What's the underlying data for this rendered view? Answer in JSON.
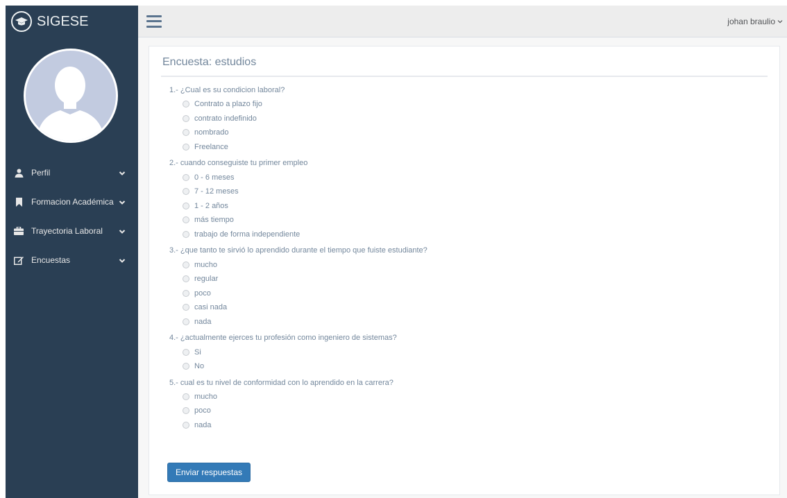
{
  "app": {
    "name": "SIGESE"
  },
  "sidebar": {
    "items": [
      {
        "label": "Perfil",
        "icon": "user-icon"
      },
      {
        "label": "Formacion Académica",
        "icon": "bookmark-icon"
      },
      {
        "label": "Trayectoria Laboral",
        "icon": "briefcase-icon"
      },
      {
        "label": "Encuestas",
        "icon": "edit-icon"
      }
    ]
  },
  "header": {
    "user": "johan braulio"
  },
  "survey": {
    "title": "Encuesta: estudios",
    "questions": [
      {
        "text": "1.- ¿Cual es su condicion laboral?",
        "options": [
          "Contrato a plazo fijo",
          "contrato indefinido",
          "nombrado",
          "Freelance"
        ]
      },
      {
        "text": "2.- cuando conseguiste tu primer empleo",
        "options": [
          "0 - 6 meses",
          "7 - 12 meses",
          "1 - 2 años",
          "más tiempo",
          "trabajo de forma independiente"
        ]
      },
      {
        "text": "3.- ¿que tanto te sirvió lo aprendido durante el tiempo que fuiste estudiante?",
        "options": [
          "mucho",
          "regular",
          "poco",
          "casi nada",
          "nada"
        ]
      },
      {
        "text": "4.- ¿actualmente ejerces tu profesión como ingeniero de sistemas?",
        "options": [
          "Si",
          "No"
        ]
      },
      {
        "text": "5.- cual es tu nivel de conformidad con lo aprendido en la carrera?",
        "options": [
          "mucho",
          "poco",
          "nada"
        ]
      }
    ],
    "submit_label": "Enviar respuestas"
  },
  "colors": {
    "sidebar": "#2a3f54",
    "accent": "#337ab7",
    "topbar": "#ededed"
  }
}
